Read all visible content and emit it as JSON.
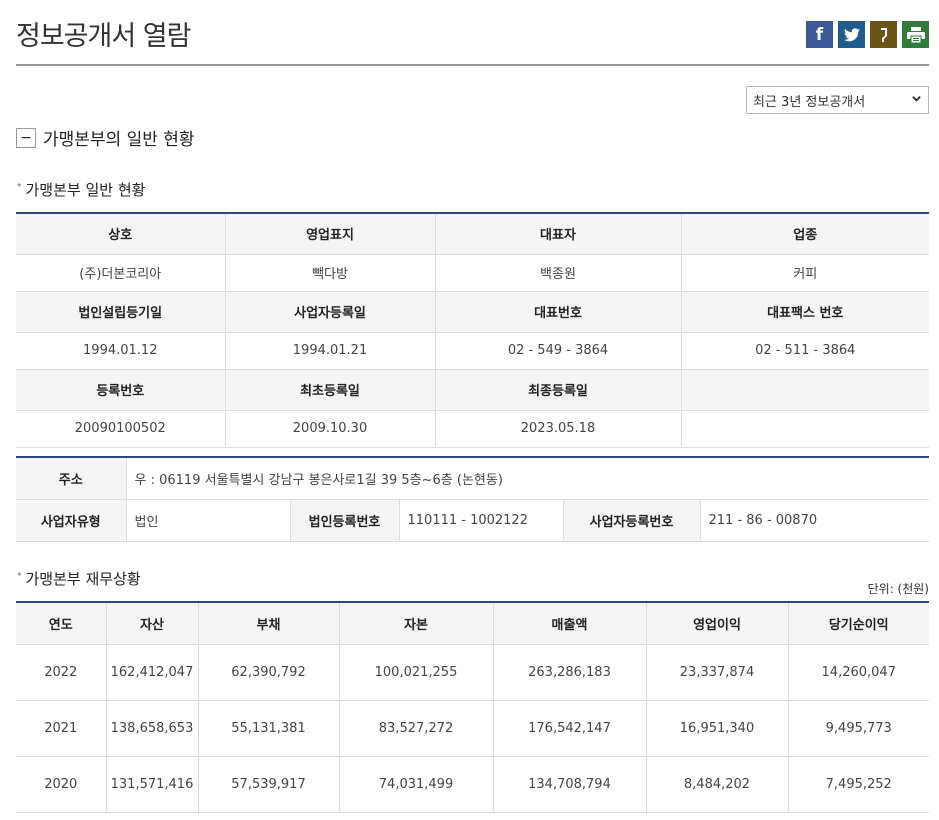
{
  "page": {
    "title": "정보공개서 열람",
    "share_icons": [
      "facebook-icon",
      "twitter-icon",
      "kakaostory-icon",
      "print-icon"
    ]
  },
  "filter": {
    "selected": "최근 3년 정보공개서"
  },
  "section": {
    "title": "가맹본부의 일반 현황",
    "toggle": "−"
  },
  "general": {
    "title": "가맹본부 일반 현황",
    "headers1": [
      "상호",
      "영업표지",
      "대표자",
      "업종"
    ],
    "values1": [
      "(주)더본코리아",
      "빽다방",
      "백종원",
      "커피"
    ],
    "headers2": [
      "법인설립등기일",
      "사업자등록일",
      "대표번호",
      "대표팩스 번호"
    ],
    "values2": [
      "1994.01.12",
      "1994.01.21",
      "02 - 549 - 3864",
      "02 - 511 - 3864"
    ],
    "headers3": [
      "등록번호",
      "최초등록일",
      "최종등록일",
      ""
    ],
    "values3": [
      "20090100502",
      "2009.10.30",
      "2023.05.18",
      ""
    ]
  },
  "address": {
    "label": "주소",
    "value": "우 : 06119 서울특별시 강남구 봉은사로1길 39 5층~6층 (논현동)",
    "biz_type_label": "사업자유형",
    "biz_type_value": "법인",
    "corp_no_label": "법인등록번호",
    "corp_no_value": "110111 - 1002122",
    "biz_no_label": "사업자등록번호",
    "biz_no_value": "211 - 86 - 00870"
  },
  "finance": {
    "title": "가맹본부 재무상황",
    "unit": "단위: (천원)",
    "headers": [
      "연도",
      "자산",
      "부채",
      "자본",
      "매출액",
      "영업이익",
      "당기순이익"
    ],
    "rows": [
      [
        "2022",
        "162,412,047",
        "62,390,792",
        "100,021,255",
        "263,286,183",
        "23,337,874",
        "14,260,047"
      ],
      [
        "2021",
        "138,658,653",
        "55,131,381",
        "83,527,272",
        "176,542,147",
        "16,951,340",
        "9,495,773"
      ],
      [
        "2020",
        "131,571,416",
        "57,539,917",
        "74,031,499",
        "134,708,794",
        "8,484,202",
        "7,495,252"
      ]
    ]
  }
}
